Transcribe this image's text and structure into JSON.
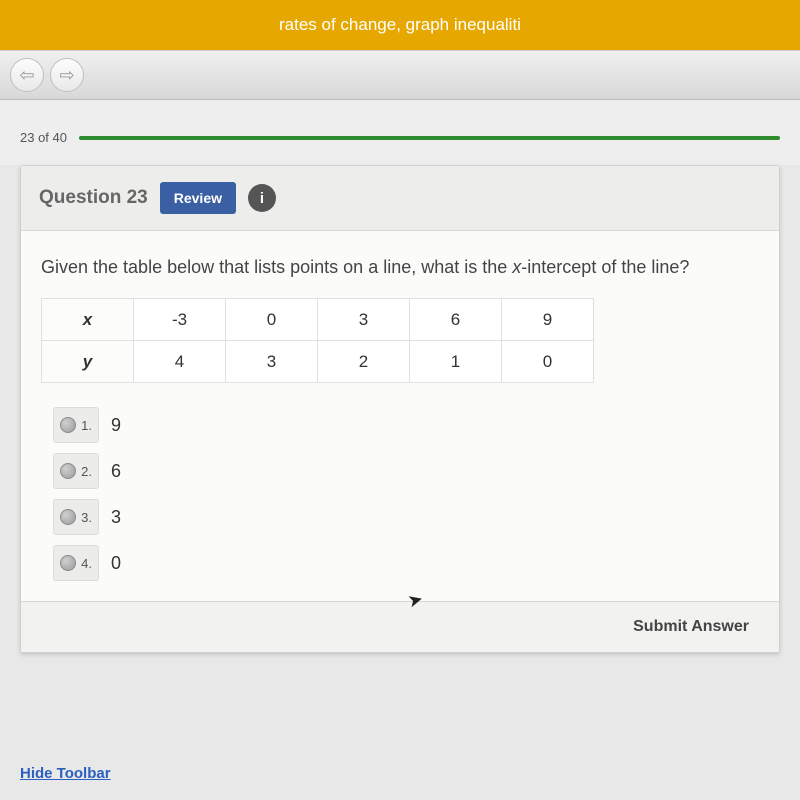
{
  "banner": {
    "subtitle": "rates of change, graph inequaliti"
  },
  "nav": {
    "back_glyph": "⟵",
    "fwd_glyph": "⟶"
  },
  "progress": {
    "label": "23 of 40"
  },
  "question": {
    "header_label": "Question 23",
    "review_label": "Review",
    "info_glyph": "i",
    "prompt_pre": "Given the table below that lists points on a line, what is the ",
    "prompt_var": "x",
    "prompt_post": "-intercept of the line?"
  },
  "table": {
    "row_x_label": "x",
    "row_y_label": "y",
    "x": [
      "-3",
      "0",
      "3",
      "6",
      "9"
    ],
    "y": [
      "4",
      "3",
      "2",
      "1",
      "0"
    ]
  },
  "answers": [
    {
      "num": "1.",
      "val": "9"
    },
    {
      "num": "2.",
      "val": "6"
    },
    {
      "num": "3.",
      "val": "3"
    },
    {
      "num": "4.",
      "val": "0"
    }
  ],
  "footer": {
    "submit_label": "Submit Answer"
  },
  "toolbar_link": "Hide Toolbar"
}
